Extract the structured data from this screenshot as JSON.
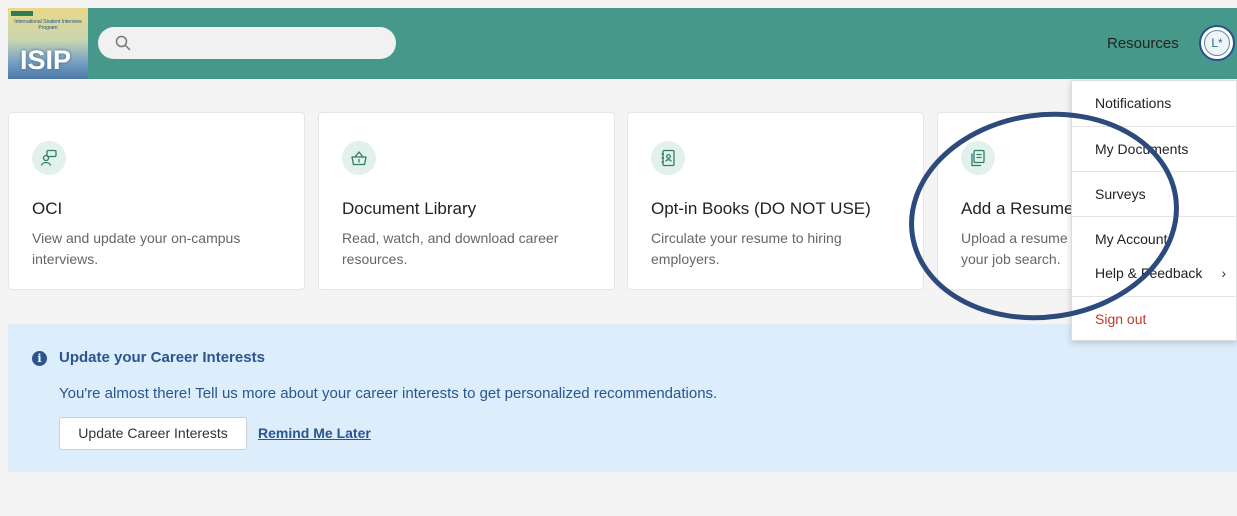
{
  "header": {
    "logo": {
      "small_text": "International Student Interview Program",
      "big_text": "ISIP"
    },
    "search": {
      "placeholder": "",
      "value": "",
      "icon": "search-icon"
    },
    "resources_label": "Resources",
    "avatar_initials": "L*"
  },
  "cards": [
    {
      "title": "OCI",
      "description": "View and update your on-campus interviews.",
      "icon": "interview-chat-icon"
    },
    {
      "title": "Document Library",
      "description": "Read, watch, and download career resources.",
      "icon": "basket-icon"
    },
    {
      "title": "Opt-in Books (DO NOT USE)",
      "description": "Circulate your resume to hiring employers.",
      "icon": "contact-book-icon"
    },
    {
      "title": "Add a Resume",
      "description": "Upload a resume your job search.",
      "icon": "document-icon"
    }
  ],
  "banner": {
    "title": "Update your Career Interests",
    "text": "You're almost there! Tell us more about your career interests to get personalized recommendations.",
    "button_label": "Update Career Interests",
    "link_label": "Remind Me Later"
  },
  "dropdown": {
    "items": [
      "Notifications",
      "My Documents",
      "Surveys",
      "My Account",
      "Help & Feedback",
      "Sign out"
    ]
  },
  "colors": {
    "header_bg": "#46998a",
    "banner_bg": "#dcedfb",
    "link_blue": "#2a5590",
    "signout_red": "#c0392b",
    "annotation_ring": "#2d4a7c"
  }
}
